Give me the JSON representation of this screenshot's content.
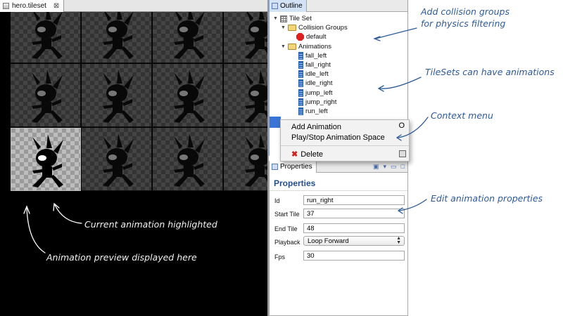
{
  "editor": {
    "tab_title": "hero.tileset",
    "tab_close": "⊠"
  },
  "outline": {
    "tab_title": "Outline",
    "tree": {
      "root": "Tile Set",
      "collision_folder": "Collision Groups",
      "collision_groups": [
        "default"
      ],
      "animations_folder": "Animations",
      "animations": [
        "fall_left",
        "fall_right",
        "idle_left",
        "idle_right",
        "jump_left",
        "jump_right",
        "run_left"
      ]
    }
  },
  "context_menu": {
    "items": [
      {
        "label": "Add Animation",
        "shortcut": "O"
      },
      {
        "label": "Play/Stop Animation Space",
        "shortcut": ""
      },
      {
        "label": "Delete",
        "icon": "delete-x-icon"
      }
    ]
  },
  "properties": {
    "tab_title": "Properties",
    "heading": "Properties",
    "fields": {
      "id": {
        "label": "Id",
        "value": "run_right"
      },
      "start_tile": {
        "label": "Start Tile",
        "value": "37"
      },
      "end_tile": {
        "label": "End Tile",
        "value": "48"
      },
      "playback": {
        "label": "Playback",
        "value": "Loop Forward"
      },
      "fps": {
        "label": "Fps",
        "value": "30"
      }
    }
  },
  "annotations": {
    "collision": [
      "Add collision groups",
      "for physics filtering"
    ],
    "animations": "TileSets can have animations",
    "context": "Context menu",
    "edit": "Edit animation properties",
    "highlight": "Current animation highlighted",
    "preview": "Animation preview displayed here"
  },
  "colors": {
    "annotation_blue": "#2d5a98",
    "selection_blue": "#3875d7",
    "collision_red": "#e01f1f"
  }
}
